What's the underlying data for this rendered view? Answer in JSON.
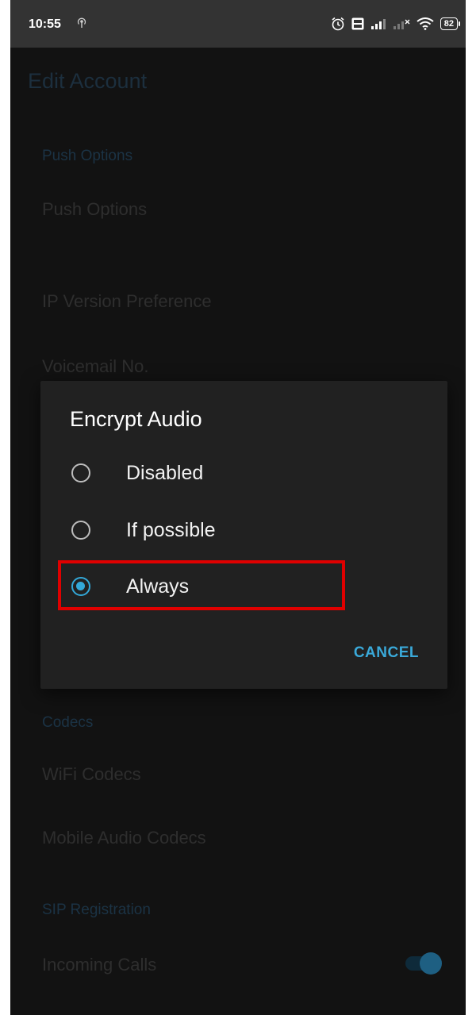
{
  "status_bar": {
    "time": "10:55",
    "battery": "82",
    "icons": [
      "hotspot-icon",
      "alarm-icon",
      "volte-icon",
      "signal-icon",
      "signal-no-service-icon",
      "wifi-icon",
      "battery-icon"
    ]
  },
  "app": {
    "title": "Edit Account"
  },
  "sections": {
    "push_header": "Push Options",
    "push_options": "Push Options",
    "ip_version": "IP Version Preference",
    "voicemail": "Voicemail No.",
    "codecs_header": "Codecs",
    "wifi_codecs": "WiFi Codecs",
    "mobile_codecs": "Mobile Audio Codecs",
    "sip_header": "SIP Registration",
    "incoming_calls": "Incoming Calls",
    "incoming_calls_enabled": true
  },
  "dialog": {
    "title": "Encrypt Audio",
    "options": [
      {
        "label": "Disabled",
        "selected": false
      },
      {
        "label": "If possible",
        "selected": false
      },
      {
        "label": "Always",
        "selected": true
      }
    ],
    "cancel_label": "CANCEL"
  },
  "colors": {
    "accent": "#33a8d8",
    "highlight": "#e00000",
    "dialog_bg": "#212121",
    "screen_bg": "#121212"
  }
}
